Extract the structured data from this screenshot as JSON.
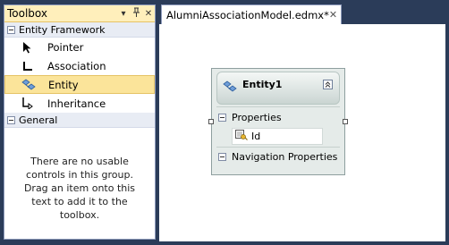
{
  "toolbox": {
    "title": "Toolbox",
    "dropdown_icon": "dropdown-arrow-icon",
    "pin_icon": "pin-icon",
    "close_icon": "close-icon",
    "groups": [
      {
        "label": "Entity Framework",
        "items": [
          {
            "label": "Pointer",
            "icon": "pointer-icon"
          },
          {
            "label": "Association",
            "icon": "association-icon"
          },
          {
            "label": "Entity",
            "icon": "entity-icon",
            "selected": true
          },
          {
            "label": "Inheritance",
            "icon": "inheritance-icon"
          }
        ]
      },
      {
        "label": "General",
        "empty_message": "There are no usable controls in this group. Drag an item onto this text to add it to the toolbox."
      }
    ]
  },
  "document": {
    "tab_label": "AlumniAssociationModel.edmx*",
    "tab_close": "✕"
  },
  "entity": {
    "name": "Entity1",
    "sections": [
      {
        "label": "Properties",
        "properties": [
          {
            "name": "Id",
            "is_key": true
          }
        ]
      },
      {
        "label": "Navigation Properties",
        "properties": []
      }
    ]
  },
  "colors": {
    "frame": "#2b3c59",
    "toolbox_title": "#ffefbb",
    "selection": "#fbe49a",
    "entity_body": "#e5ebe9"
  }
}
